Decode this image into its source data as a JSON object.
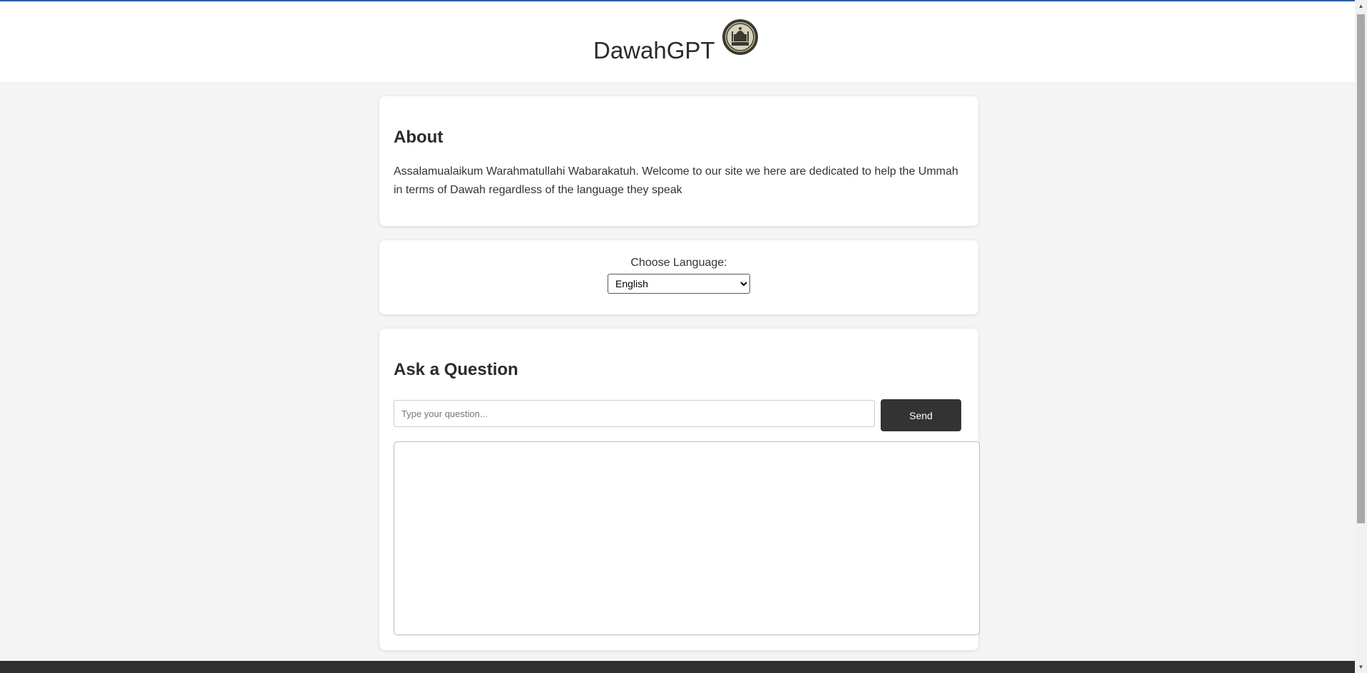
{
  "header": {
    "title": "DawahGPT",
    "logo_icon": "mosque-emblem-icon"
  },
  "about": {
    "heading": "About",
    "text": "Assalamualaikum Warahmatullahi Wabarakatuh. Welcome to our site we here are dedicated to help the Ummah in terms of Dawah regardless of the language they speak"
  },
  "language": {
    "label": "Choose Language:",
    "selected": "English"
  },
  "ask": {
    "heading": "Ask a Question",
    "placeholder": "Type your question...",
    "send_label": "Send"
  },
  "colors": {
    "accent_topline": "#2f5fa8",
    "button_bg": "#333333",
    "page_bg": "#f4f4f4",
    "footer_bg": "#2f2f2f"
  }
}
